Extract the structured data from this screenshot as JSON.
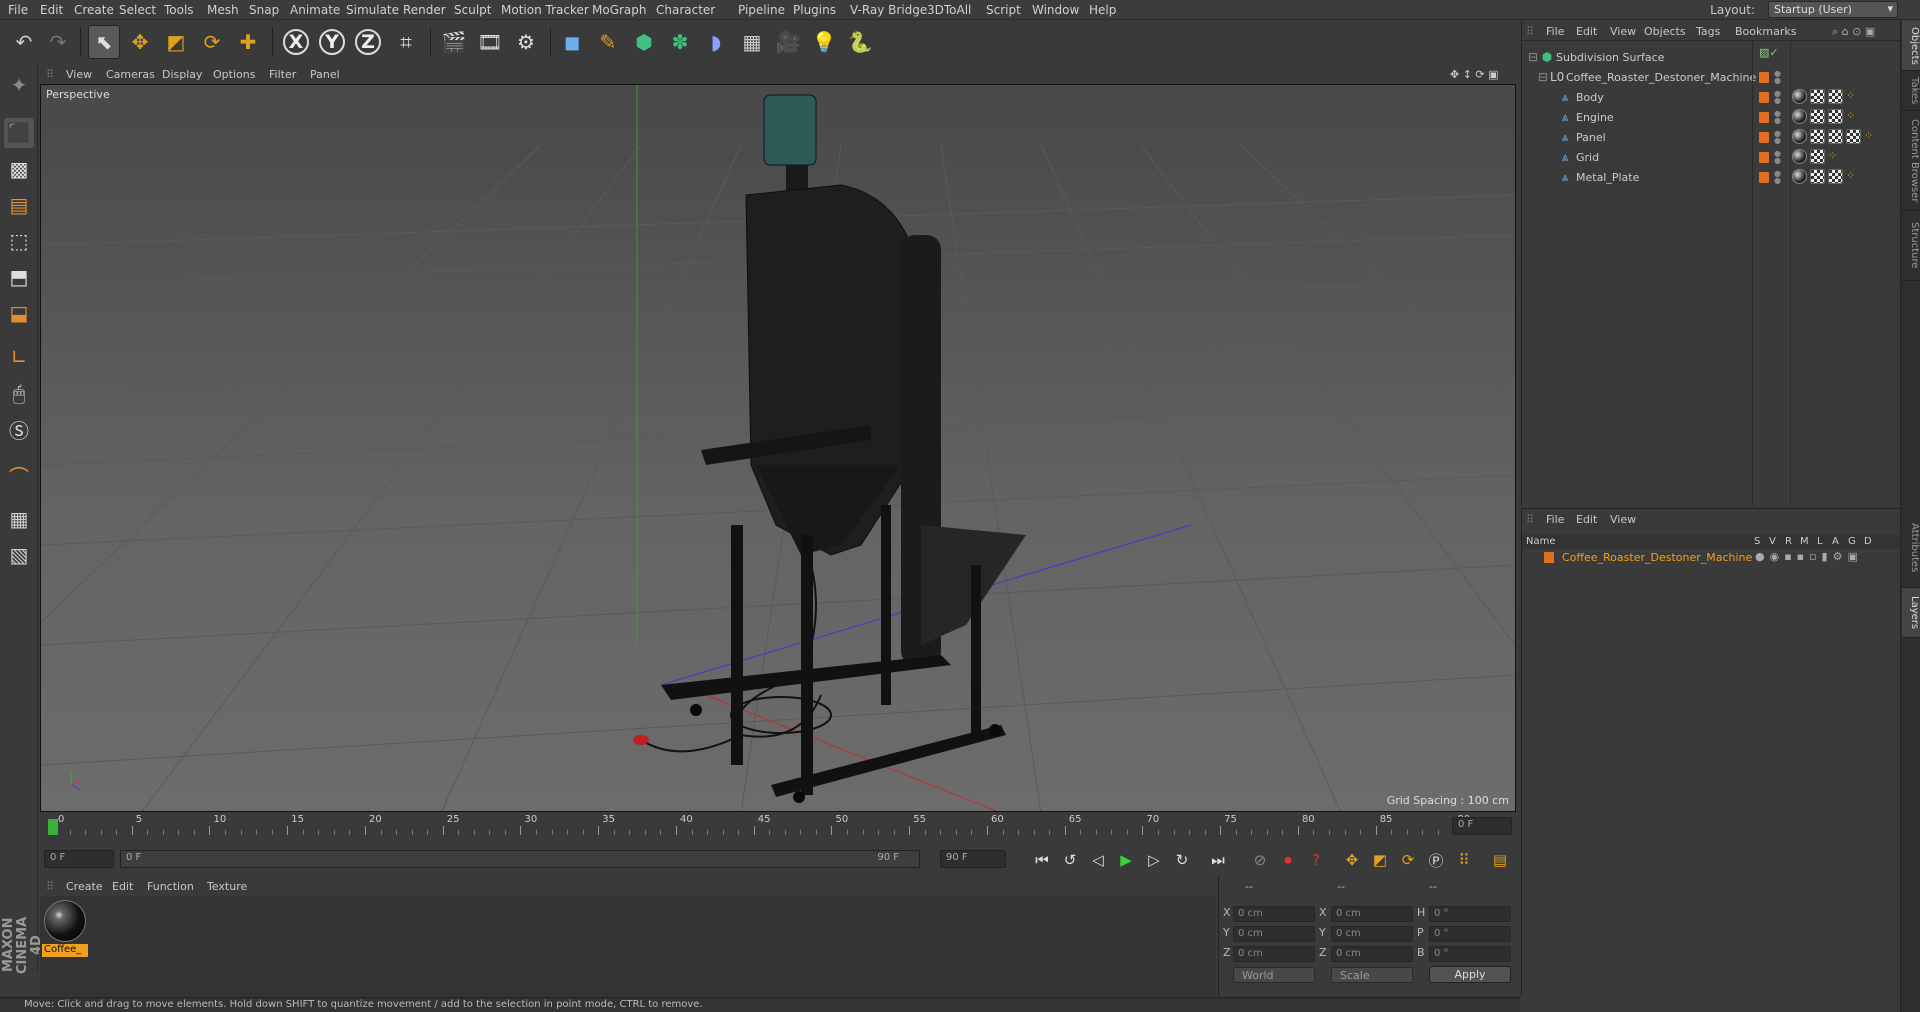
{
  "menubar": {
    "items": [
      "File",
      "Edit",
      "Create",
      "Select",
      "Tools",
      "Mesh",
      "Snap",
      "Animate",
      "Simulate",
      "Render",
      "Sculpt",
      "Motion Tracker",
      "MoGraph",
      "Character",
      "Pipeline",
      "Plugins",
      "V-Ray Bridge",
      "3DToAll",
      "Script",
      "Window",
      "Help"
    ],
    "layout_label": "Layout:",
    "layout_value": "Startup (User)"
  },
  "viewport": {
    "menu": [
      "View",
      "Cameras",
      "Display",
      "Options",
      "Filter",
      "Panel"
    ],
    "camera_label": "Perspective",
    "grid_spacing": "Grid Spacing : 100 cm"
  },
  "timeline": {
    "ticks": [
      "0",
      "5",
      "10",
      "15",
      "20",
      "25",
      "30",
      "35",
      "40",
      "45",
      "50",
      "55",
      "60",
      "65",
      "70",
      "75",
      "80",
      "85",
      "90"
    ],
    "current_frame": "0 F",
    "start_field": "0 F",
    "range_start": "0 F",
    "range_end": "90 F",
    "end_field": "90 F"
  },
  "material_manager": {
    "menu": [
      "Create",
      "Edit",
      "Function",
      "Texture"
    ],
    "material_name": "Coffee_"
  },
  "coordinates": {
    "headers": [
      "--",
      "--",
      "--"
    ],
    "rows": [
      {
        "a": "X",
        "av": "0 cm",
        "b": "X",
        "bv": "0 cm",
        "c": "H",
        "cv": "0 °"
      },
      {
        "a": "Y",
        "av": "0 cm",
        "b": "Y",
        "bv": "0 cm",
        "c": "P",
        "cv": "0 °"
      },
      {
        "a": "Z",
        "av": "0 cm",
        "b": "Z",
        "bv": "0 cm",
        "c": "B",
        "cv": "0 °"
      }
    ],
    "space": "World",
    "mode": "Scale",
    "apply_label": "Apply"
  },
  "status_text": "Move: Click and drag to move elements. Hold down SHIFT to quantize movement / add to the selection in point mode, CTRL to remove.",
  "object_manager": {
    "menu": [
      "File",
      "Edit",
      "View",
      "Objects",
      "Tags",
      "Bookmarks"
    ],
    "objects": [
      {
        "name": "Subdivision Surface",
        "indent": 0
      },
      {
        "name": "Coffee_Roaster_Destoner_Machine",
        "indent": 1
      },
      {
        "name": "Body",
        "indent": 2
      },
      {
        "name": "Engine",
        "indent": 2
      },
      {
        "name": "Panel",
        "indent": 2
      },
      {
        "name": "Grid",
        "indent": 2
      },
      {
        "name": "Metal_Plate",
        "indent": 2
      }
    ]
  },
  "layer_manager": {
    "menu": [
      "File",
      "Edit",
      "View"
    ],
    "columns": [
      "Name",
      "S",
      "V",
      "R",
      "M",
      "L",
      "A",
      "G",
      "D"
    ],
    "layer_name": "Coffee_Roaster_Destoner_Machine"
  },
  "side_tabs": [
    "Objects",
    "Takes",
    "Content Browser",
    "Structure",
    "Attributes",
    "Layers"
  ],
  "brand": "MAXON CINEMA 4D"
}
